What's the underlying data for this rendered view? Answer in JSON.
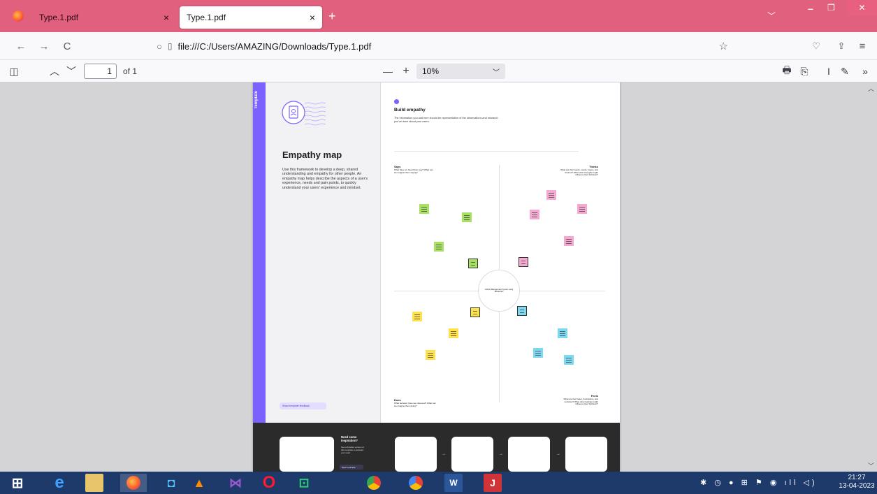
{
  "tabs": [
    {
      "title": "Type.1.pdf",
      "close": "×"
    },
    {
      "title": "Type.1.pdf",
      "close": "×"
    }
  ],
  "new_tab": "+",
  "window_controls": {
    "minimize": "–",
    "maximize": "❐",
    "close": "✕"
  },
  "nav": {
    "back": "←",
    "forward": "→",
    "reload": "C",
    "url": "file:///C:/Users/AMAZING/Downloads/Type.1.pdf"
  },
  "pdf_toolbar": {
    "page_current": "1",
    "page_of": "of 1",
    "zoom_out": "—",
    "zoom_in": "+",
    "zoom": "10%"
  },
  "page": {
    "template_label": "Template",
    "title": "Empathy map",
    "description": "Use this framework to develop a deep, shared understanding and empathy for other people. An empathy map helps describe the aspects of a user's experience, needs and pain points, to quickly understand your users' experience and mindset.",
    "feedback": "Share template feedback",
    "build_title": "Build empathy",
    "build_desc": "The information you add here should be representative of the observations and research you've done about your users.",
    "says_title": "Says",
    "says_desc": "What have we heard them say? What can we imagine them saying?",
    "thinks_title": "Thinks",
    "thinks_desc": "What are their wants, needs, hopes, and dreams? What other thoughts might influence their behavior?",
    "does_title": "Does",
    "does_desc": "What behavior have we observed? What can we imagine them doing?",
    "feels_title": "Feels",
    "feels_desc": "What are their fears, frustrations, and anxieties? What other feelings might influence their behavior?",
    "center_label": "Vehicle Management System using Blockchain",
    "inspiration_title": "Need some inspiration?",
    "inspiration_desc": "See a finished version of this template to kickstart your work.",
    "open_example": "Open example"
  },
  "taskbar": {
    "time": "21:27",
    "date": "13-04-2023"
  },
  "colors": {
    "tabbar": "#e0607e",
    "accent": "#7b61ff",
    "note_green": "#a8e063",
    "note_pink": "#f5a9d0",
    "note_yellow": "#ffe14d",
    "note_blue": "#7dd8f0"
  }
}
